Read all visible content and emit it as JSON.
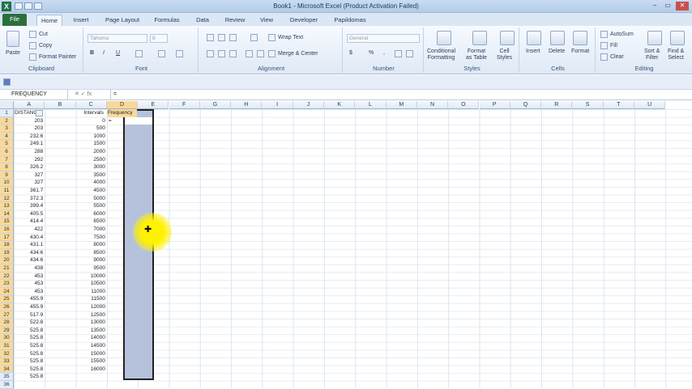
{
  "window": {
    "title": "Book1 - Microsoft Excel (Product Activation Failed)",
    "app_icon": "X",
    "controls": [
      "–",
      "▭",
      "✕"
    ]
  },
  "tabs": [
    "File",
    "Home",
    "Insert",
    "Page Layout",
    "Formulas",
    "Data",
    "Review",
    "View",
    "Developer",
    "Papildomas"
  ],
  "ribbon": {
    "clipboard": {
      "label": "Clipboard",
      "paste": "Paste",
      "cut": "Cut",
      "copy": "Copy",
      "format_painter": "Format Painter"
    },
    "font": {
      "label": "Font",
      "font_name": "Tahoma",
      "font_size": "8",
      "bold": "B",
      "italic": "I",
      "underline": "U"
    },
    "alignment": {
      "label": "Alignment",
      "wrap_text": "Wrap Text",
      "merge_center": "Merge & Center"
    },
    "number": {
      "label": "Number",
      "format": "General",
      "currency": "$",
      "percent": "%",
      "comma": ","
    },
    "styles": {
      "label": "Styles",
      "conditional": "Conditional\nFormatting",
      "format_table": "Format\nas Table",
      "cell_styles": "Cell\nStyles"
    },
    "cells": {
      "label": "Cells",
      "insert": "Insert",
      "delete": "Delete",
      "format": "Format"
    },
    "editing": {
      "label": "Editing",
      "autosum": "AutoSum",
      "fill": "Fill",
      "clear": "Clear",
      "sort_filter": "Sort &\nFilter",
      "find_select": "Find &\nSelect"
    }
  },
  "formula_bar": {
    "name_box": "FREQUENCY",
    "fx_buttons": "✕ ✓ fx",
    "content": "="
  },
  "columns": [
    "A",
    "B",
    "C",
    "D",
    "E",
    "F",
    "G",
    "H",
    "I",
    "J",
    "K",
    "L",
    "M",
    "N",
    "O",
    "P",
    "Q",
    "R",
    "S",
    "T",
    "U"
  ],
  "rows": [
    "1",
    "2",
    "3",
    "4",
    "5",
    "6",
    "7",
    "8",
    "9",
    "10",
    "11",
    "12",
    "13",
    "14",
    "15",
    "16",
    "17",
    "18",
    "19",
    "20",
    "21",
    "22",
    "23",
    "24",
    "25",
    "26",
    "27",
    "28",
    "29",
    "30",
    "31",
    "32",
    "33",
    "34",
    "35",
    "36"
  ],
  "headers": {
    "a1": "DISTANCE",
    "c1": "Intervals",
    "d1": "Frequency"
  },
  "active_cell_text": "=",
  "col_a": [
    "203",
    "203",
    "232.6",
    "249.1",
    "288",
    "292",
    "326.2",
    "327",
    "327",
    "361.7",
    "372.3",
    "399.4",
    "405.5",
    "414.4",
    "422",
    "430.4",
    "431.1",
    "434.6",
    "434.6",
    "438",
    "453",
    "453",
    "453",
    "455.9",
    "455.9",
    "517.9",
    "522.8",
    "525.8",
    "525.8",
    "525.8",
    "525.8",
    "525.8",
    "525.8",
    "525.8"
  ],
  "col_c": [
    "0",
    "500",
    "1000",
    "1500",
    "2000",
    "2500",
    "3000",
    "3500",
    "4000",
    "4500",
    "5000",
    "5500",
    "6000",
    "6500",
    "7000",
    "7500",
    "8000",
    "8500",
    "9000",
    "9500",
    "10000",
    "10500",
    "11000",
    "11500",
    "12000",
    "12500",
    "13000",
    "13500",
    "14000",
    "14500",
    "15000",
    "15500",
    "16000"
  ],
  "colors": {
    "file_tab": "#2b6f3c",
    "selection": "#b6c2dc",
    "highlight": "#fff200"
  }
}
